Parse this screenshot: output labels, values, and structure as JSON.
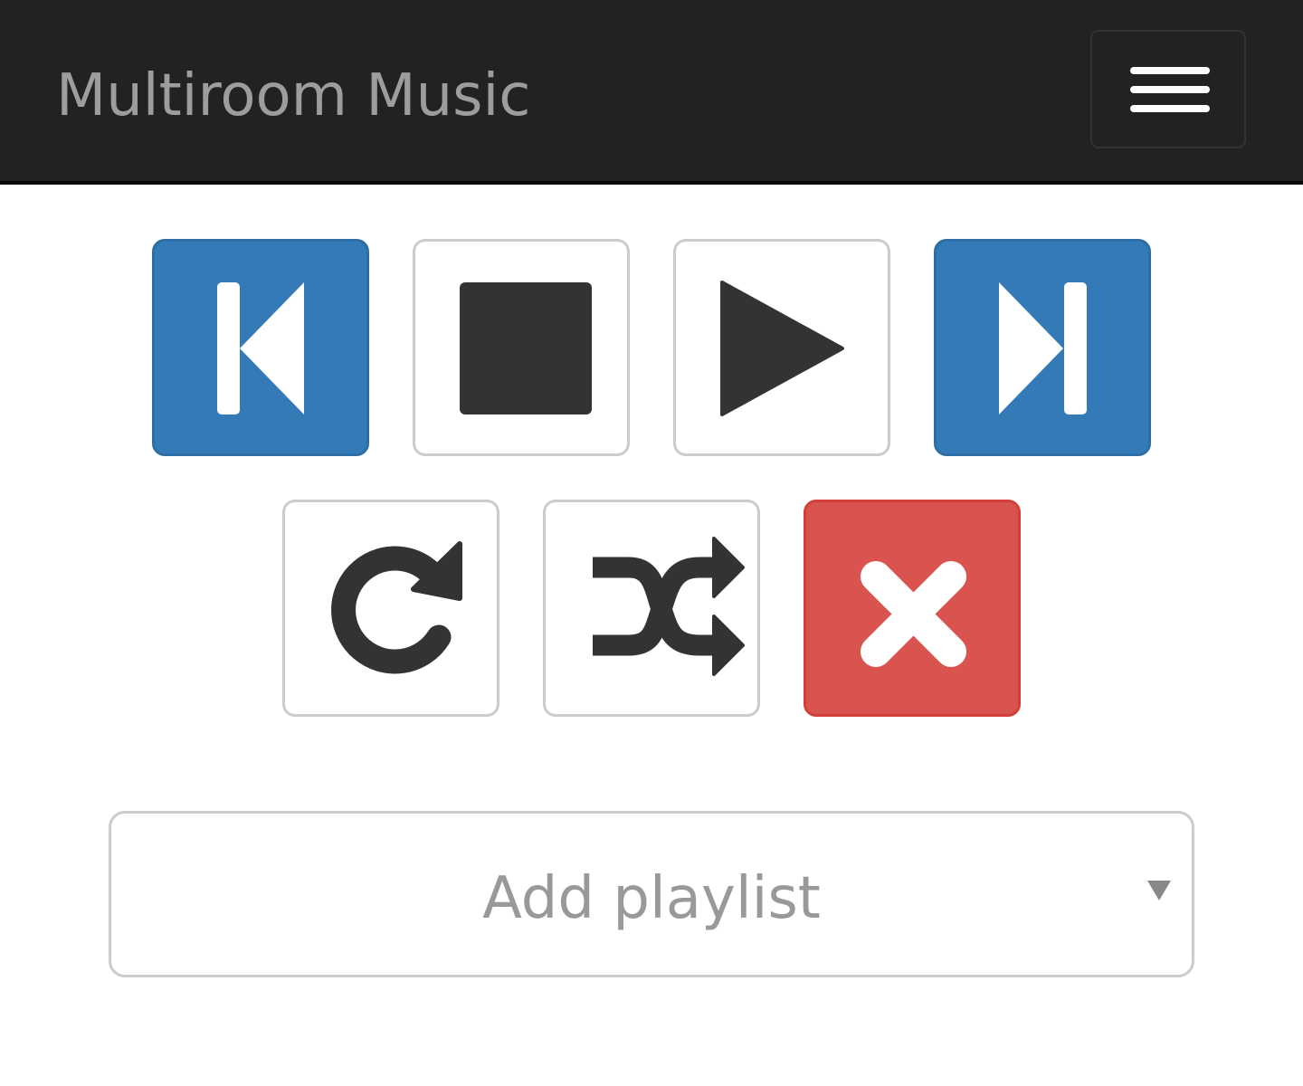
{
  "navbar": {
    "brand": "Multiroom Music",
    "toggle_icon": "hamburger-menu-icon"
  },
  "controls": {
    "row1": [
      {
        "name": "previous",
        "icon": "step-backward-icon",
        "style": "primary"
      },
      {
        "name": "stop",
        "icon": "stop-icon",
        "style": "default"
      },
      {
        "name": "play",
        "icon": "play-icon",
        "style": "default"
      },
      {
        "name": "next",
        "icon": "step-forward-icon",
        "style": "primary"
      }
    ],
    "row2": [
      {
        "name": "repeat",
        "icon": "repeat-icon",
        "style": "default"
      },
      {
        "name": "shuffle",
        "icon": "shuffle-icon",
        "style": "default"
      },
      {
        "name": "clear",
        "icon": "close-icon",
        "style": "danger"
      }
    ]
  },
  "playlist_select": {
    "placeholder": "Add playlist",
    "caret_icon": "caret-down-icon"
  },
  "colors": {
    "navbar_bg": "#222222",
    "brand_text": "#9d9d9d",
    "primary": "#337ab7",
    "danger": "#d9534f",
    "icon_dark": "#333333",
    "border": "#cccccc"
  }
}
